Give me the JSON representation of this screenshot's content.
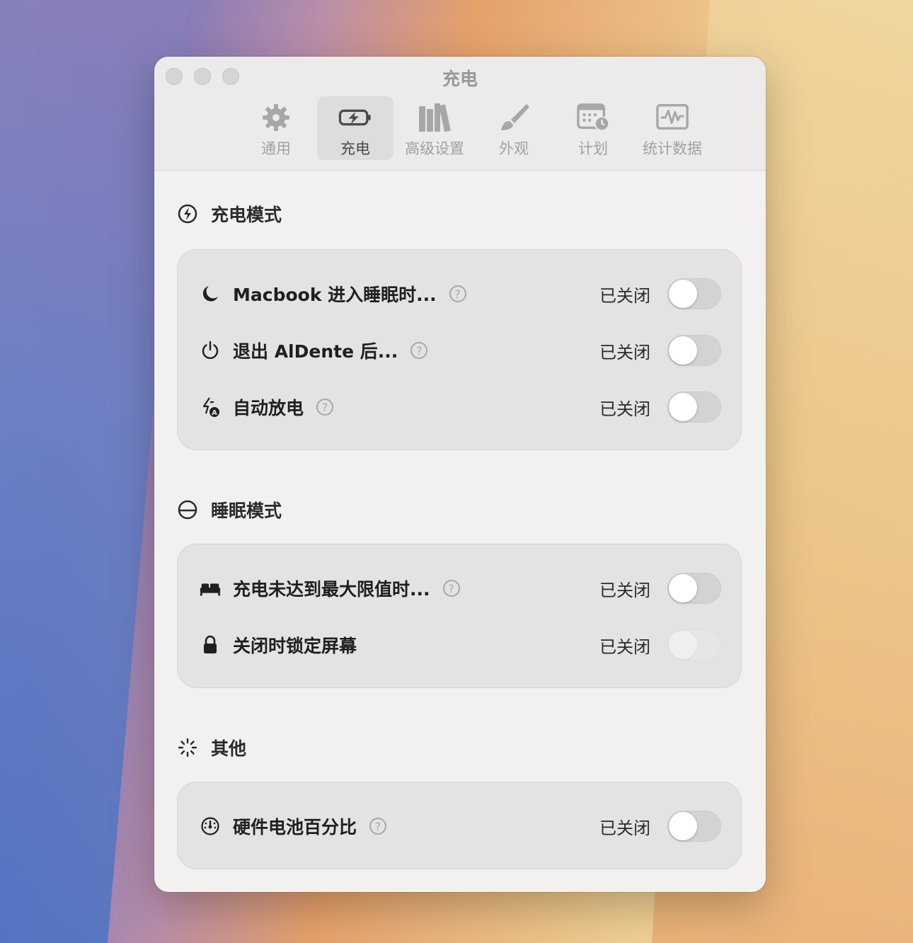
{
  "window": {
    "title": "充电"
  },
  "toolbar": {
    "tabs": [
      {
        "label": "通用",
        "icon": "gear-icon"
      },
      {
        "label": "充电",
        "icon": "battery-charging-icon",
        "selected": true
      },
      {
        "label": "高级设置",
        "icon": "books-icon"
      },
      {
        "label": "外观",
        "icon": "paintbrush-icon"
      },
      {
        "label": "计划",
        "icon": "calendar-clock-icon"
      },
      {
        "label": "统计数据",
        "icon": "waveform-monitor-icon"
      }
    ]
  },
  "sections": {
    "charging_mode": {
      "title": "充电模式",
      "icon": "bolt-circle-icon",
      "rows": [
        {
          "label": "Macbook 进入睡眠时...",
          "status": "已关闭",
          "icon": "moon-icon",
          "enabled": false
        },
        {
          "label": "退出 AlDente 后...",
          "status": "已关闭",
          "icon": "power-icon",
          "enabled": false
        },
        {
          "label": "自动放电",
          "status": "已关闭",
          "icon": "auto-discharge-icon",
          "enabled": false
        }
      ]
    },
    "sleep_mode": {
      "title": "睡眠模式",
      "icon": "half-circle-icon",
      "rows": [
        {
          "label": "充电未达到最大限值时...",
          "status": "已关闭",
          "icon": "bed-icon",
          "enabled": false
        },
        {
          "label": "关闭时锁定屏幕",
          "status": "已关闭",
          "icon": "lock-icon",
          "enabled": false,
          "disabled": true
        }
      ]
    },
    "other": {
      "title": "其他",
      "icon": "spinner-icon",
      "rows": [
        {
          "label": "硬件电池百分比",
          "status": "已关闭",
          "icon": "gauge-icon",
          "enabled": false
        }
      ]
    }
  },
  "colors": {
    "window_bg": "#f2f1f0",
    "card_bg": "#e4e3e2",
    "toggle_off": "#d4d3d2"
  }
}
